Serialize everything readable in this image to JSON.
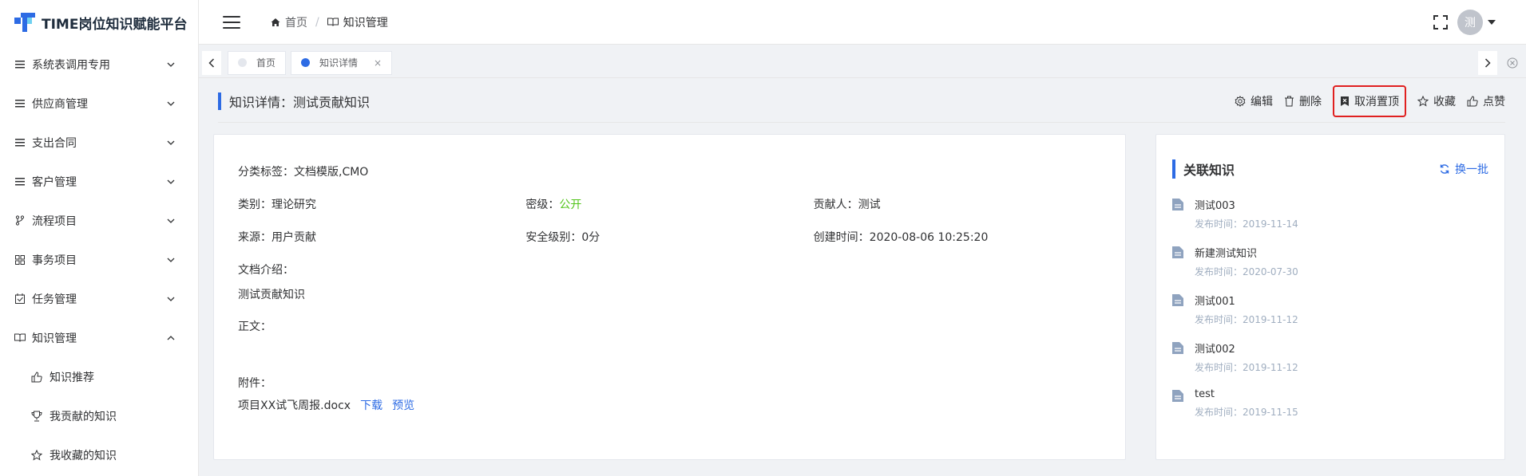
{
  "app": {
    "title": "TIME岗位知识赋能平台"
  },
  "sidebar": {
    "items": [
      {
        "label": "系统表调用专用",
        "icon": "list-icon",
        "expanded": false
      },
      {
        "label": "供应商管理",
        "icon": "list-icon",
        "expanded": false
      },
      {
        "label": "支出合同",
        "icon": "list-icon",
        "expanded": false
      },
      {
        "label": "客户管理",
        "icon": "list-icon",
        "expanded": false
      },
      {
        "label": "流程项目",
        "icon": "branch-icon",
        "expanded": false
      },
      {
        "label": "事务项目",
        "icon": "grid-icon",
        "expanded": false
      },
      {
        "label": "任务管理",
        "icon": "calendar-check-icon",
        "expanded": false
      },
      {
        "label": "知识管理",
        "icon": "book-icon",
        "expanded": true
      }
    ],
    "subitems": [
      {
        "label": "知识推荐",
        "icon": "thumbs-up-icon"
      },
      {
        "label": "我贡献的知识",
        "icon": "trophy-icon"
      },
      {
        "label": "我收藏的知识",
        "icon": "star-icon"
      }
    ]
  },
  "header": {
    "breadcrumb": [
      {
        "label": "首页",
        "icon": "home-icon"
      },
      {
        "label": "知识管理",
        "icon": "book-icon"
      }
    ],
    "breadcrumb_sep": "/",
    "avatar_text": "测"
  },
  "tabs": [
    {
      "label": "首页",
      "active": false,
      "dot_color": "#e4e7ed"
    },
    {
      "label": "知识详情",
      "active": true,
      "dot_color": "#2d6be4",
      "close": "×"
    }
  ],
  "page": {
    "title": "知识详情：测试贡献知识",
    "actions": [
      {
        "label": "编辑",
        "icon": "gear-icon"
      },
      {
        "label": "删除",
        "icon": "trash-icon"
      },
      {
        "label": "取消置顶",
        "icon": "bookmark-x-icon",
        "highlighted": true
      },
      {
        "label": "收藏",
        "icon": "star-icon"
      },
      {
        "label": "点赞",
        "icon": "thumbs-up-icon"
      }
    ]
  },
  "detail": {
    "category_label": "分类标签：",
    "category_value": "文档模版,CMO",
    "type_label": "类别：",
    "type_value": "理论研究",
    "secret_label": "密级：",
    "secret_value": "公开",
    "contributor_label": "贡献人：",
    "contributor_value": "测试",
    "source_label": "来源：",
    "source_value": "用户贡献",
    "safety_label": "安全级别：",
    "safety_value": "0分",
    "created_label": "创建时间：",
    "created_value": "2020-08-06 10:25:20",
    "intro_label": "文档介绍：",
    "intro_value": "测试贡献知识",
    "body_label": "正文：",
    "attach_label": "附件：",
    "attach_file": "项目XX试飞周报.docx",
    "download": "下载",
    "preview": "预览"
  },
  "related": {
    "title": "关联知识",
    "refresh": "换一批",
    "date_prefix": "发布时间：",
    "items": [
      {
        "name": "测试003",
        "date": "发布时间：2019-11-14"
      },
      {
        "name": "新建测试知识",
        "date": "发布时间：2020-07-30"
      },
      {
        "name": "测试001",
        "date": "发布时间：2019-11-12"
      },
      {
        "name": "测试002",
        "date": "发布时间：2019-11-12"
      },
      {
        "name": "test",
        "date": "发布时间：2019-11-15"
      }
    ]
  },
  "colors": {
    "accent": "#2d6be4",
    "highlight_border": "#e02020",
    "public_green": "#52c41a"
  }
}
